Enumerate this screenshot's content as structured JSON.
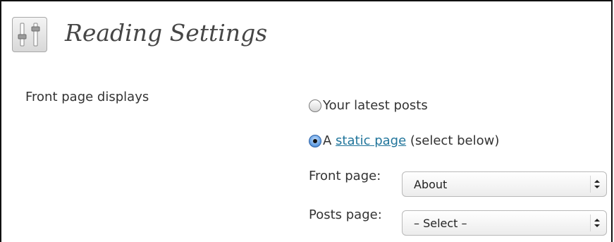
{
  "page": {
    "title": "Reading Settings",
    "icon": "settings-sliders-icon"
  },
  "front_page_displays": {
    "label": "Front page displays",
    "options": [
      {
        "text": "Your latest posts",
        "checked": false
      },
      {
        "prefix": "A ",
        "link_text": "static page",
        "suffix": " (select below)",
        "checked": true
      }
    ]
  },
  "front_page": {
    "label": "Front page:",
    "selected": "About"
  },
  "posts_page": {
    "label": "Posts page:",
    "selected": "– Select –"
  },
  "colors": {
    "link": "#21759b",
    "title": "#464646",
    "radio_selected": "#2d6cc0"
  }
}
